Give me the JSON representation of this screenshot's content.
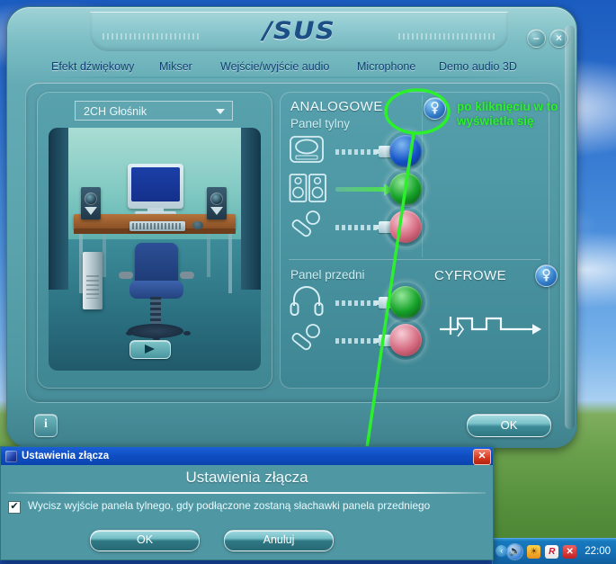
{
  "window": {
    "logo": "/SUS",
    "minimize_label": "–",
    "close_label": "×",
    "tabs": [
      {
        "label": "Efekt dźwiękowy"
      },
      {
        "label": "Mikser"
      },
      {
        "label": "Wejście/wyjście audio"
      },
      {
        "label": "Microphone"
      },
      {
        "label": "Demo audio 3D"
      }
    ],
    "footer": {
      "info_label": "i",
      "ok_label": "OK"
    }
  },
  "left_pane": {
    "speaker_select_value": "2CH Głośnik",
    "play_button_label": ""
  },
  "right_pane": {
    "analog_title": "ANALOGOWE",
    "rear_panel_title": "Panel tylny",
    "front_panel_title": "Panel przedni",
    "digital_title": "CYFROWE",
    "analog_config_icon": "wrench-icon",
    "digital_config_icon": "wrench-icon",
    "rear_jacks": [
      {
        "device": "line-in-device-icon",
        "color": "#1452c8",
        "name": "line-in",
        "active": false
      },
      {
        "device": "speakers-icon",
        "color": "#17a32a",
        "name": "line-out-speakers",
        "active": true
      },
      {
        "device": "microphone-icon",
        "color": "#d4697f",
        "name": "mic-in-rear",
        "active": false
      }
    ],
    "front_jacks": [
      {
        "device": "headphone-icon",
        "color": "#17a32a",
        "name": "headphone-out",
        "active": false
      },
      {
        "device": "microphone-icon",
        "color": "#d4697f",
        "name": "mic-in-front",
        "active": false
      }
    ]
  },
  "annotations": {
    "line1": "po kliknięciu w to",
    "line2": "wyświetla się",
    "pointer_label": "to",
    "color": "#2bf02b"
  },
  "dialog": {
    "titlebar_title": "Ustawienia złącza",
    "heading": "Ustawienia złącza",
    "checkbox_checked": true,
    "checkbox_mark": "✔",
    "checkbox_label": "Wycisz wyjście panela tylnego, gdy podłączone zostaną słachawki panela przedniego",
    "ok_label": "OK",
    "cancel_label": "Anuluj",
    "close_label": "✕"
  },
  "taskbar": {
    "tray_handle": "‹",
    "icons": [
      {
        "name": "volume-icon",
        "glyph": "🔊"
      },
      {
        "name": "sun-icon",
        "glyph": "☀"
      },
      {
        "name": "avira-icon",
        "glyph": "R"
      },
      {
        "name": "error-icon",
        "glyph": "✕"
      }
    ],
    "clock": "22:00"
  }
}
